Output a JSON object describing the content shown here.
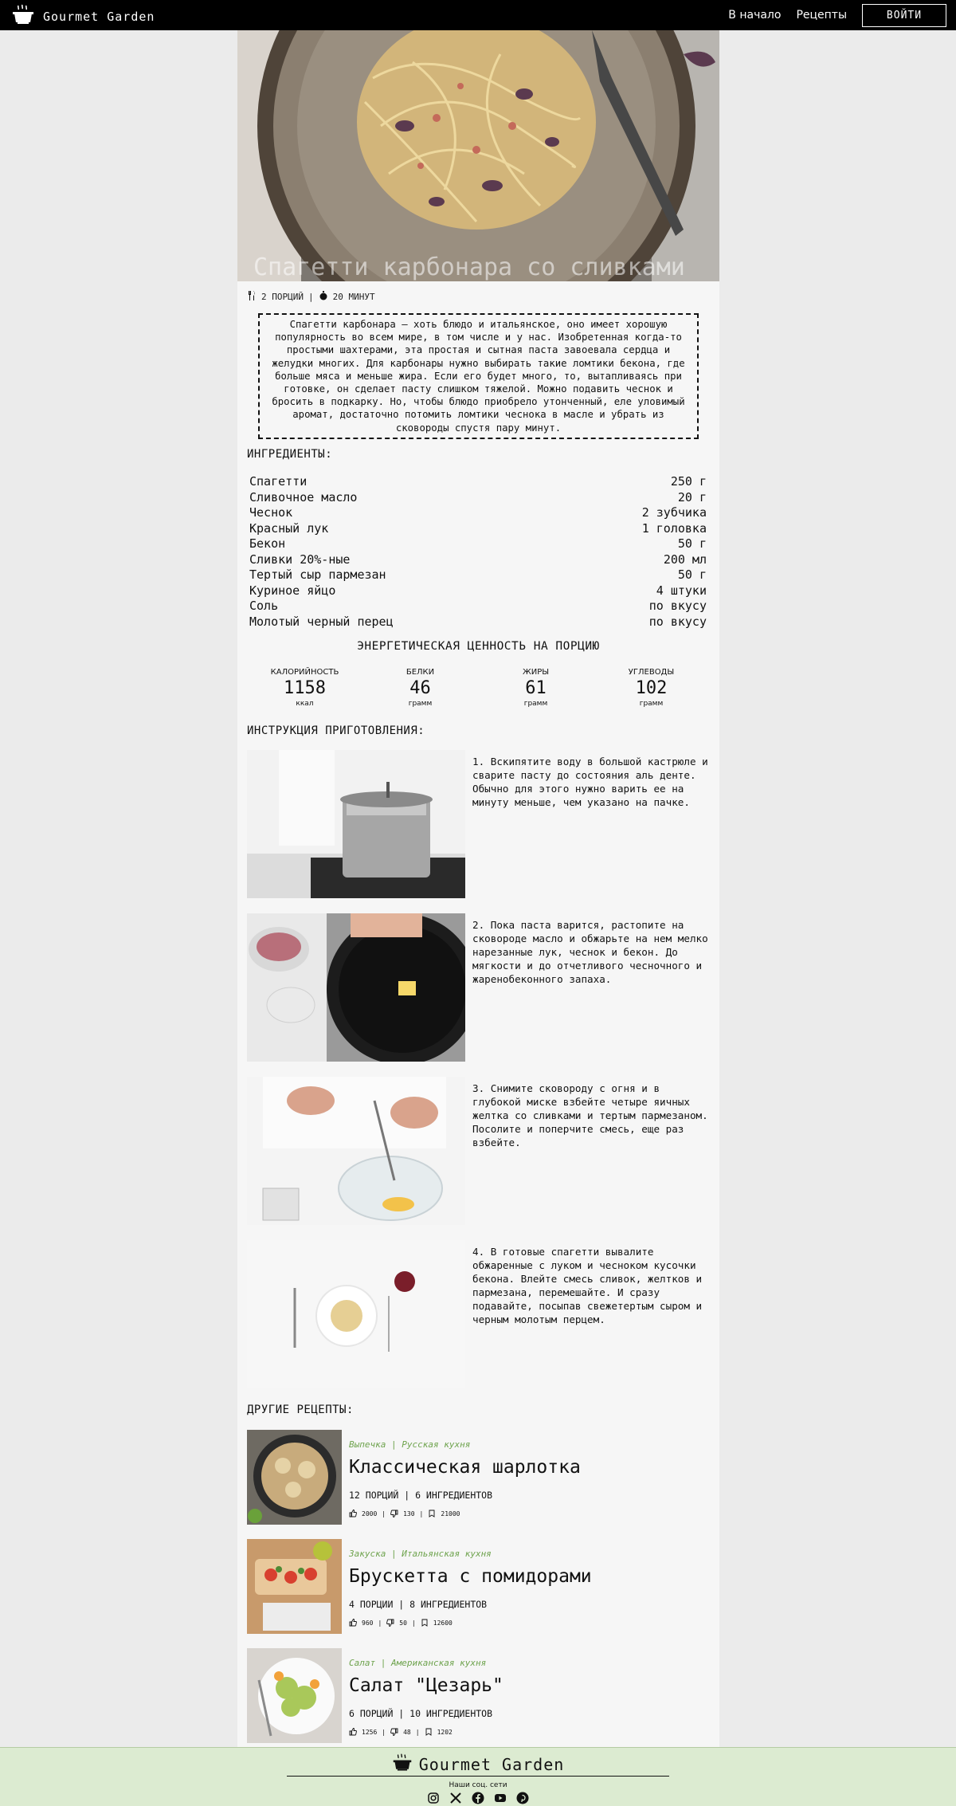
{
  "header": {
    "brand": "Gourmet Garden",
    "nav": [
      "В начало",
      "Рецепты"
    ],
    "login": "ВОЙТИ"
  },
  "recipe": {
    "title": "Спагетти карбонара со сливками",
    "portions": "2 ПОРЦИЙ",
    "separator": "|",
    "time": "20 МИНУТ",
    "description": "Спагетти карбонара — хоть блюдо и итальянское, оно имеет хорошую популярность во всем мире, в том числе и у нас. Изобретенная когда-то простыми шахтерами, эта простая и сытная паста завоевала сердца и желудки многих. Для карбонары нужно выбирать такие ломтики бекона, где больше мяса и меньше жира. Если его будет много, то, вытапливаясь при готовке, он сделает пасту слишком тяжелой. Можно подавить чеснок и бросить в подкарку. Но, чтобы блюдо приобрело утонченный, еле уловимый аромат, достаточно потомить ломтики чеснока в масле и убрать из сковороды спустя пару минут."
  },
  "ingredients_title": "ИНГРЕДИЕНТЫ:",
  "ingredients": [
    {
      "name": "Спагетти",
      "amount": "250 г"
    },
    {
      "name": "Сливочное масло",
      "amount": "20 г"
    },
    {
      "name": "Чеснок",
      "amount": "2 зубчика"
    },
    {
      "name": "Красный лук",
      "amount": "1 головка"
    },
    {
      "name": "Бекон",
      "amount": "50 г"
    },
    {
      "name": "Сливки 20%-ные",
      "amount": "200 мл"
    },
    {
      "name": "Тертый сыр пармезан",
      "amount": "50 г"
    },
    {
      "name": "Куриное яйцо",
      "amount": "4 штуки"
    },
    {
      "name": "Соль",
      "amount": "по вкусу"
    },
    {
      "name": "Молотый черный перец",
      "amount": "по вкусу"
    }
  ],
  "energy": {
    "title": "ЭНЕРГЕТИЧЕСКАЯ ЦЕННОСТЬ НА ПОРЦИЮ",
    "items": [
      {
        "label": "КАЛОРИЙНОСТЬ",
        "value": "1158",
        "unit": "ккал"
      },
      {
        "label": "БЕЛКИ",
        "value": "46",
        "unit": "грамм"
      },
      {
        "label": "ЖИРЫ",
        "value": "61",
        "unit": "грамм"
      },
      {
        "label": "УГЛЕВОДЫ",
        "value": "102",
        "unit": "грамм"
      }
    ]
  },
  "instructions_title": "ИНСТРУКЦИЯ ПРИГОТОВЛЕНИЯ:",
  "steps": [
    "1. Вскипятите воду в большой кастрюле и сварите пасту до состояния аль денте. Обычно для этого нужно варить ее на минуту меньше, чем указано на пачке.",
    "2. Пока паста варится, растопите на сковороде масло и обжарьте на нем мелко нарезанные лук, чеснок и бекон. До мягкости и до отчетливого чесночного и жаренобеконного запаха.",
    "3. Снимите сковороду с огня и в глубокой миске взбейте четыре яичных желтка со сливками и тертым пармезаном. Посолите и поперчите смесь, еще раз взбейте.",
    "4. В готовые спагетти вывалите обжаренные с луком и чесноком кусочки бекона. Влейте смесь сливок, желтков и пармезана, перемешайте. И сразу подавайте, посыпав свежетертым сыром и черным молотым перцем."
  ],
  "other_title": "ДРУГИЕ РЕЦЕПТЫ:",
  "other_recipes": [
    {
      "category": "Выпечка  |  Русская кухня",
      "title": "Классическая шарлотка",
      "meta": "12 ПОРЦИЙ  |  6 ИНГРЕДИЕНТОВ",
      "likes": "2000",
      "dislikes": "130",
      "saves": "21000"
    },
    {
      "category": "Закуска  |  Итальянская кухня",
      "title": "Брускетта с помидорами",
      "meta": "4 ПОРЦИИ  |  8 ИНГРЕДИЕНТОВ",
      "likes": "960",
      "dislikes": "50",
      "saves": "12600"
    },
    {
      "category": "Салат  |  Американская кухня",
      "title": "Салат \"Цезарь\"",
      "meta": "6 ПОРЦИЙ  |  10 ИНГРЕДИЕНТОВ",
      "likes": "1256",
      "dislikes": "48",
      "saves": "1202"
    }
  ],
  "footer": {
    "brand": "Gourmet Garden",
    "social_title": "Наши соц. сети",
    "social": [
      "instagram-icon",
      "x-icon",
      "facebook-icon",
      "youtube-icon",
      "pinterest-icon"
    ]
  },
  "colors": {
    "accent_green": "#6ea34d",
    "footer_bg": "#dcebd1",
    "header_bg": "#000000"
  }
}
